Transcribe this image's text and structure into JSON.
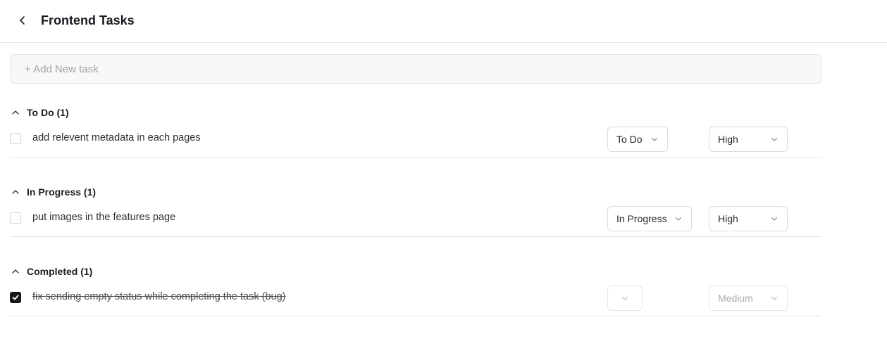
{
  "header": {
    "title": "Frontend Tasks",
    "back_icon": "chevron-left-icon"
  },
  "add_task": {
    "placeholder": "+ Add New task",
    "value": ""
  },
  "sections": [
    {
      "title": "To Do (1)",
      "tasks": [
        {
          "text": "add relevent metadata in each pages",
          "checked": false,
          "status": "To Do",
          "priority": "High"
        }
      ]
    },
    {
      "title": "In Progress (1)",
      "tasks": [
        {
          "text": "put images in the features page",
          "checked": false,
          "status": "In Progress",
          "priority": "High"
        }
      ]
    },
    {
      "title": "Completed (1)",
      "tasks": [
        {
          "text": "fix sending empty status while completing the task (bug)",
          "checked": true,
          "status": "",
          "priority": "Medium"
        }
      ]
    }
  ],
  "colors": {
    "checkbox_checked": "#14171a",
    "border": "#e4e4e4",
    "muted_text": "#a9a9a9"
  }
}
